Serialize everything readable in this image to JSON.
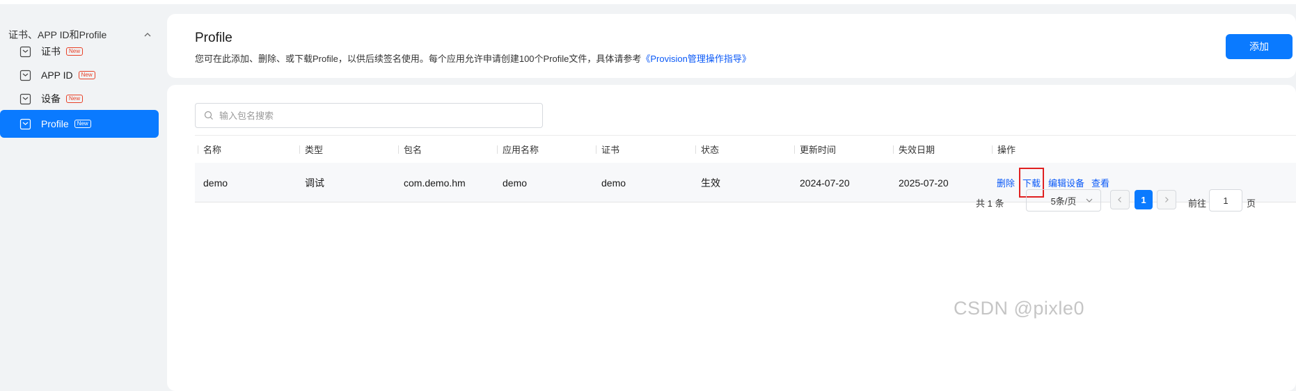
{
  "sidebar": {
    "group_title": "证书、APP ID和Profile",
    "items": [
      {
        "label": "证书",
        "badge": "New"
      },
      {
        "label": "APP ID",
        "badge": "New"
      },
      {
        "label": "设备",
        "badge": "New"
      },
      {
        "label": "Profile",
        "badge": "New",
        "active": true
      }
    ]
  },
  "header": {
    "title": "Profile",
    "description": "您可在此添加、删除、或下载Profile，以供后续签名使用。每个应用允许申请创建100个Profile文件，具体请参考",
    "link": "《Provision管理操作指导》",
    "add_label": "添加"
  },
  "search": {
    "placeholder": "输入包名搜索",
    "value": ""
  },
  "table": {
    "columns": [
      "名称",
      "类型",
      "包名",
      "应用名称",
      "证书",
      "状态",
      "更新时间",
      "失效日期",
      "操作"
    ],
    "rows": [
      {
        "name": "demo",
        "type": "调试",
        "package": "com.demo.hm",
        "app_name": "demo",
        "cert": "demo",
        "status": "生效",
        "updated": "2024-07-20",
        "expires": "2025-07-20",
        "actions": [
          "删除",
          "下载",
          "编辑设备",
          "查看"
        ]
      }
    ]
  },
  "pagination": {
    "total": "共 1 条",
    "page_size": "5条/页",
    "current_page": "1",
    "goto_label": "前往",
    "goto_value": "1",
    "page_suffix": "页"
  },
  "watermark": "CSDN @pixle0",
  "colors": {
    "primary": "#0a7aff",
    "link": "#0a59f7",
    "badge": "#e84026",
    "highlight_box": "#e02020"
  }
}
